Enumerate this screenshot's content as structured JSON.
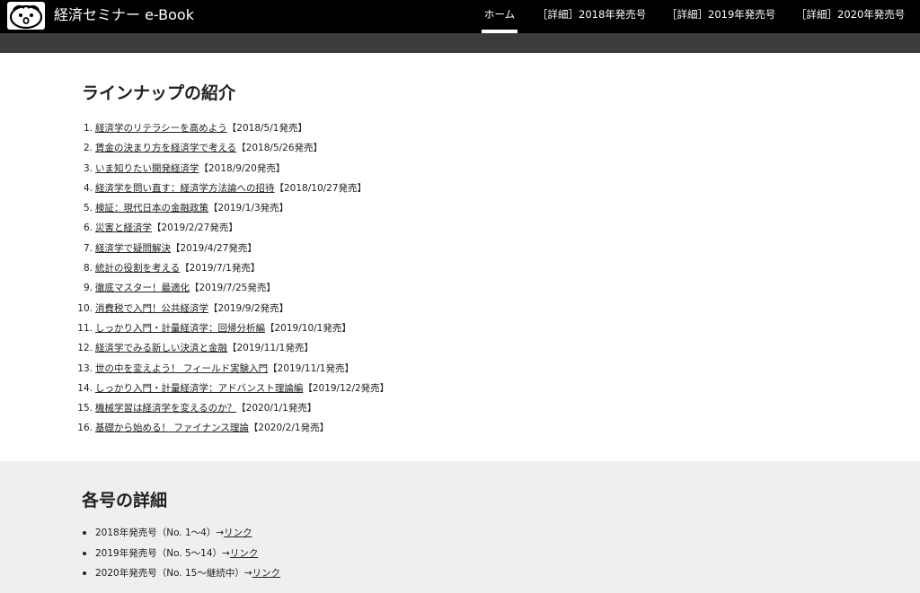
{
  "header": {
    "site_title": "経済セミナー e-Book",
    "nav": [
      "ホーム",
      "［詳細］2018年発売号",
      "［詳細］2019年発売号",
      "［詳細］2020年発売号"
    ],
    "active_nav": "ホーム"
  },
  "lineup": {
    "heading": "ラインナップの紹介",
    "items": [
      {
        "num": "1.",
        "title": "経済学のリテラシーを高めよう",
        "release": "【2018/5/1発売】"
      },
      {
        "num": "2.",
        "title": "賃金の決まり方を経済学で考える",
        "release": "【2018/5/26発売】"
      },
      {
        "num": "3.",
        "title": "いま知りたい開発経済学",
        "release": "【2018/9/20発売】"
      },
      {
        "num": "4.",
        "title": "経済学を問い直す：経済学方法論への招待",
        "release": "【2018/10/27発売】"
      },
      {
        "num": "5.",
        "title": "検証：現代日本の金融政策",
        "release": "【2019/1/3発売】"
      },
      {
        "num": "6.",
        "title": "災害と経済学",
        "release": "【2019/2/27発売】"
      },
      {
        "num": "7.",
        "title": "経済学で疑問解決",
        "release": "【2019/4/27発売】"
      },
      {
        "num": "8.",
        "title": "統計の役割を考える",
        "release": "【2019/7/1発売】"
      },
      {
        "num": "9.",
        "title": "徹底マスター！最適化",
        "release": "【2019/7/25発売】"
      },
      {
        "num": "10.",
        "title": "消費税で入門！公共経済学",
        "release": "【2019/9/2発売】"
      },
      {
        "num": "11.",
        "title": "しっかり入門・計量経済学：回帰分析編",
        "release": "【2019/10/1発売】"
      },
      {
        "num": "12.",
        "title": "経済学でみる新しい決済と金融",
        "release": "【2019/11/1発売】"
      },
      {
        "num": "13.",
        "title": "世の中を変えよう！ フィールド実験入門",
        "release": "【2019/11/1発売】"
      },
      {
        "num": "14.",
        "title": "しっかり入門・計量経済学：アドバンスト理論編",
        "release": "【2019/12/2発売】"
      },
      {
        "num": "15.",
        "title": "機械学習は経済学を変えるのか？",
        "release": "【2020/1/1発売】"
      },
      {
        "num": "16.",
        "title": "基礎から始める！ ファイナンス理論",
        "release": "【2020/2/1発売】"
      }
    ]
  },
  "details": {
    "heading": "各号の詳細",
    "items": [
      {
        "text": "2018年発売号（No. 1～4）→",
        "link": "リンク"
      },
      {
        "text": "2019年発売号（No. 5～14）→",
        "link": "リンク"
      },
      {
        "text": "2020年発売号（No. 15～継続中）→",
        "link": "リンク"
      }
    ]
  }
}
